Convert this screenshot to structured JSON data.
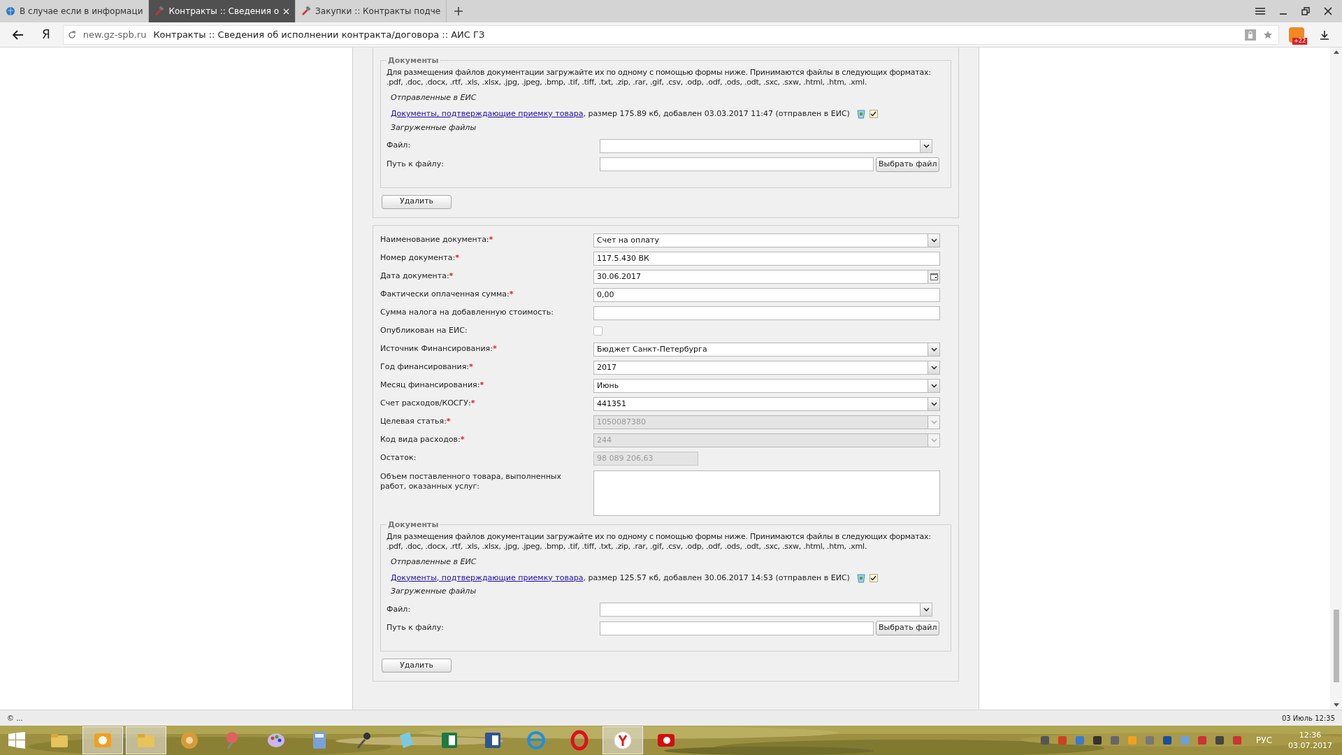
{
  "browser": {
    "tabs": [
      {
        "title": "В случае если в информаци",
        "selected": false
      },
      {
        "title": "Контракты :: Сведения о",
        "selected": true
      },
      {
        "title": "Закупки :: Контракты подче",
        "selected": false
      }
    ],
    "logo": "Я",
    "domain": "new.gz-spb.ru",
    "page_title": "Контракты :: Сведения об исполнении контракта/договора :: АИС ГЗ",
    "badge": "+22"
  },
  "sections": [
    {
      "documents": {
        "legend": "Документы",
        "hint_lines": [
          "Для размещения файлов документации загружайте их по одному с помощью формы ниже. Принимаются файлы в следующих форматах:",
          ".pdf, .doc, .docx, .rtf, .xls, .xlsx, .jpg, .jpeg, .bmp, .tif, .tiff, .txt, .zip, .rar, .gif, .csv, .odp, .odf, .ods, .odt, .sxc, .sxw, .html, .htm, .xml."
        ],
        "sent_heading": "Отправленные в ЕИС",
        "files": [
          {
            "link": "Документы, подтверждающие приемку товара",
            "details": ", размер 175.89 кб, добавлен 03.03.2017 11:47 (отправлен в ЕИС)",
            "checked": true
          }
        ],
        "uploaded_heading": "Загруженные файлы",
        "file_label": "Файл:",
        "path_label": "Путь к файлу:",
        "choose_button": "Выбрать файл"
      },
      "delete_button": "Удалить"
    },
    {
      "fields": [
        {
          "label": "Наименование документа:",
          "mark": "*",
          "kind": "select",
          "value": "Счет на оплату",
          "disabled": false
        },
        {
          "label": "Номер документа:",
          "mark": "*",
          "kind": "text",
          "value": "117.5.430 ВК",
          "disabled": false
        },
        {
          "label": "Дата документа:",
          "mark": "*",
          "kind": "date",
          "value": "30.06.2017",
          "disabled": false
        },
        {
          "label": "Фактически оплаченная сумма:",
          "mark": "*",
          "kind": "text",
          "value": "0,00",
          "disabled": false
        },
        {
          "label": "Сумма налога на добавленную стоимость:",
          "kind": "text",
          "disabled": false
        },
        {
          "label": "Опубликован на ЕИС:",
          "kind": "checkbox",
          "checked": false,
          "disabled": false
        },
        {
          "label": "Источник Финансирования:",
          "mark": "*",
          "kind": "select",
          "value": "Бюджет Санкт-Петербурга",
          "disabled": false
        },
        {
          "label": "Год финансирования:",
          "mark": "*",
          "kind": "select",
          "value": "2017",
          "disabled": false
        },
        {
          "label": "Месяц финансирования:",
          "mark": "*",
          "kind": "select",
          "value": "Июнь",
          "disabled": false
        },
        {
          "label": "Счет расходов/КОСГУ:",
          "mark": "*",
          "kind": "select",
          "value": "441351",
          "disabled": false
        },
        {
          "label": "Целевая статья:",
          "mark": "*",
          "kind": "select",
          "value": "1050087380",
          "disabled": true
        },
        {
          "label": "Код вида расходов:",
          "mark": "*",
          "kind": "select",
          "value": "244",
          "disabled": true
        },
        {
          "label": "Остаток:",
          "kind": "short",
          "value": "98 089 206,63",
          "disabled": true
        },
        {
          "label": "Объем поставленного товара, выполненных работ, оказанных услуг:",
          "kind": "textarea",
          "disabled": false
        }
      ],
      "documents": {
        "legend": "Документы",
        "hint_lines": [
          "Для размещения файлов документации загружайте их по одному с помощью формы ниже. Принимаются файлы в следующих форматах:",
          ".pdf, .doc, .docx, .rtf, .xls, .xlsx, .jpg, .jpeg, .bmp, .tif, .tiff, .txt, .zip, .rar, .gif, .csv, .odp, .odf, .ods, .odt, .sxc, .sxw, .html, .htm, .xml."
        ],
        "sent_heading": "Отправленные в ЕИС",
        "files": [
          {
            "link": "Документы, подтверждающие приемку товара",
            "details": ", размер 125.57 кб, добавлен 30.06.2017 14:53 (отправлен в ЕИС)",
            "checked": true
          }
        ],
        "uploaded_heading": "Загруженные файлы",
        "file_label": "Файл:",
        "path_label": "Путь к файлу:",
        "choose_button": "Выбрать файл"
      },
      "delete_button": "Удалить"
    }
  ],
  "status_bar": {
    "left": "© ...",
    "right": "03 Июль 12:35"
  },
  "taskbar": {
    "apps": [
      {
        "kind": "folder",
        "selected": false
      },
      {
        "kind": "mail",
        "selected": true
      },
      {
        "kind": "folder",
        "selected": true
      },
      {
        "kind": "orb",
        "selected": false
      },
      {
        "kind": "pin",
        "selected": false
      },
      {
        "kind": "palette",
        "selected": false
      },
      {
        "kind": "calculator",
        "selected": false
      },
      {
        "kind": "microphone",
        "selected": false
      },
      {
        "kind": "notepad",
        "selected": false
      },
      {
        "kind": "sheet",
        "selected": false
      },
      {
        "kind": "document",
        "selected": false
      },
      {
        "kind": "globe",
        "selected": false
      },
      {
        "kind": "ring",
        "selected": false
      },
      {
        "kind": "yandex",
        "selected": true
      },
      {
        "kind": "record",
        "selected": false
      }
    ],
    "language": "РУС",
    "time": "12:36",
    "date": "03.07.2017"
  }
}
